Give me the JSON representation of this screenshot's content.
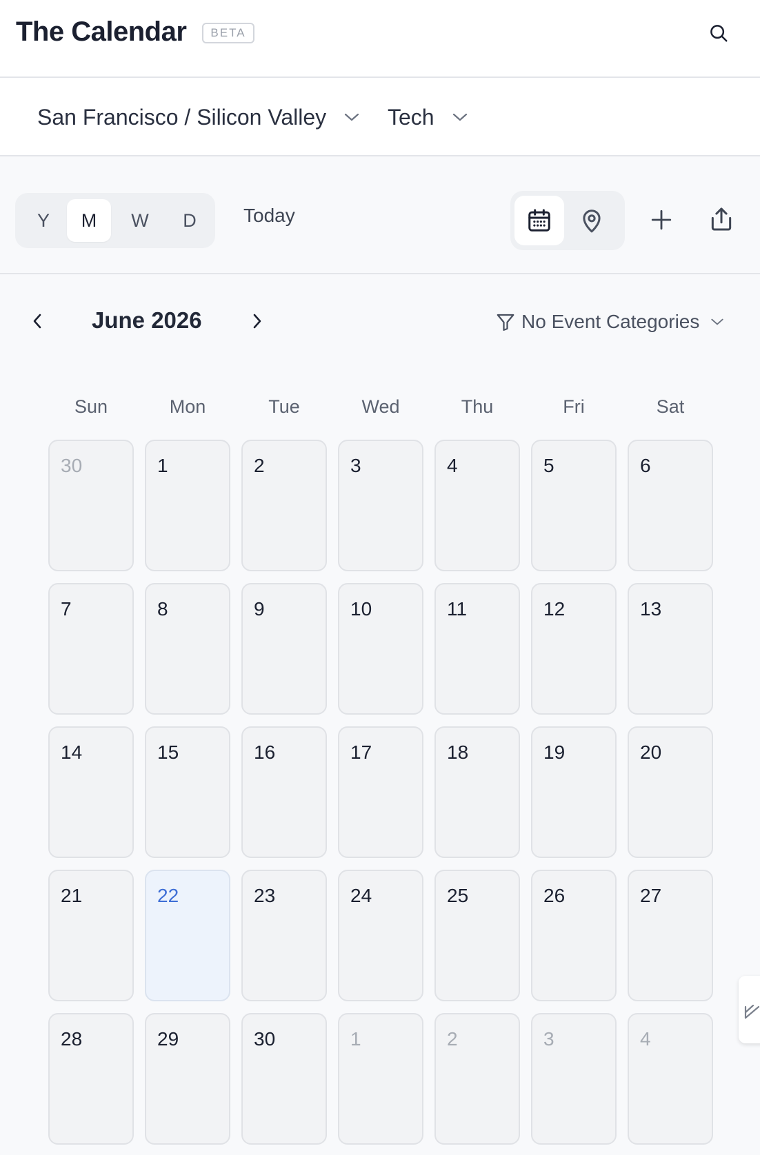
{
  "header": {
    "title": "The Calendar",
    "badge": "BETA"
  },
  "filters": {
    "region": "San Francisco / Silicon Valley",
    "category": "Tech"
  },
  "toolbar": {
    "views": [
      "Y",
      "M",
      "W",
      "D"
    ],
    "active_view": "M",
    "today_label": "Today",
    "display_modes": [
      "calendar-icon",
      "map-pin-icon"
    ],
    "active_display_mode": "calendar-icon"
  },
  "month_nav": {
    "label": "June 2026",
    "category_filter": "No Event Categories"
  },
  "weekdays": [
    "Sun",
    "Mon",
    "Tue",
    "Wed",
    "Thu",
    "Fri",
    "Sat"
  ],
  "weeks": [
    [
      {
        "day": "30",
        "outside": true
      },
      {
        "day": "1"
      },
      {
        "day": "2"
      },
      {
        "day": "3"
      },
      {
        "day": "4"
      },
      {
        "day": "5"
      },
      {
        "day": "6"
      }
    ],
    [
      {
        "day": "7"
      },
      {
        "day": "8"
      },
      {
        "day": "9"
      },
      {
        "day": "10"
      },
      {
        "day": "11"
      },
      {
        "day": "12"
      },
      {
        "day": "13"
      }
    ],
    [
      {
        "day": "14"
      },
      {
        "day": "15"
      },
      {
        "day": "16"
      },
      {
        "day": "17"
      },
      {
        "day": "18"
      },
      {
        "day": "19"
      },
      {
        "day": "20"
      }
    ],
    [
      {
        "day": "21"
      },
      {
        "day": "22",
        "today": true
      },
      {
        "day": "23"
      },
      {
        "day": "24"
      },
      {
        "day": "25"
      },
      {
        "day": "26"
      },
      {
        "day": "27"
      }
    ],
    [
      {
        "day": "28"
      },
      {
        "day": "29"
      },
      {
        "day": "30"
      },
      {
        "day": "1",
        "outside": true
      },
      {
        "day": "2",
        "outside": true
      },
      {
        "day": "3",
        "outside": true
      },
      {
        "day": "4",
        "outside": true
      }
    ]
  ],
  "colors": {
    "accent_today": "#3f6fd6",
    "today_cell_bg": "#edf3fc"
  }
}
